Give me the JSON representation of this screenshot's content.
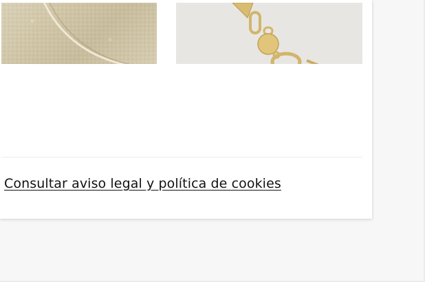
{
  "footer": {
    "legal_link": "Consultar aviso legal y política de cookies"
  },
  "products": [
    {
      "image_icon": "gold-leather-bag-image"
    },
    {
      "image_icon": "gold-chain-necklace-image"
    }
  ],
  "colors": {
    "page_background": "#f7f7f7",
    "card_background": "#ffffff",
    "link_text": "#111111",
    "divider": "#ececec",
    "gold": "#d9bf72"
  }
}
